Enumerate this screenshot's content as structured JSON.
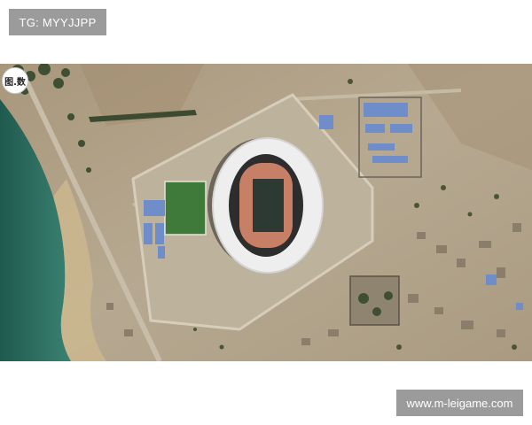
{
  "top_tag": {
    "text": "TG: MYYJJPP"
  },
  "badge": {
    "text": "图.数"
  },
  "bottom_tag": {
    "text": "www.m-leigame.com"
  },
  "photo": {
    "subject": "aerial-satellite-view-stadium",
    "colors": {
      "water": "#2e7263",
      "terrain": "#b3a58f",
      "stadium_roof": "#f2f2f2",
      "pitch": "#2d3a33",
      "running_track": "#c77f66",
      "training_field": "#3f7a3b",
      "roofs_blue": "#6f8dc9"
    }
  }
}
